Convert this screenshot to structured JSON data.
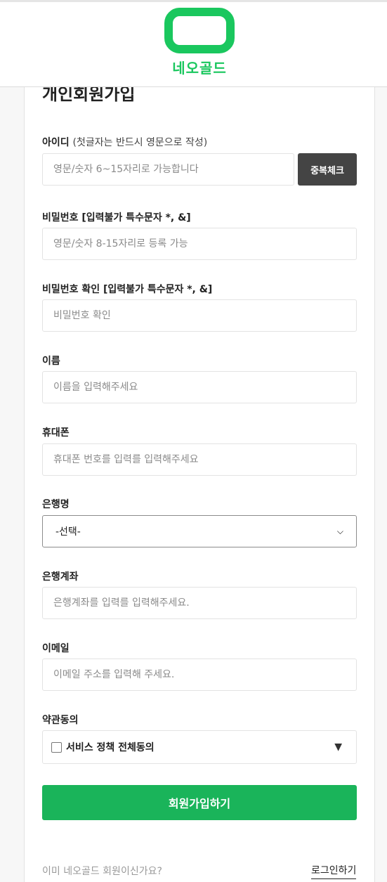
{
  "brand": {
    "name": "네오골드",
    "color": "#1ac75e"
  },
  "page_title": "개인회원가입",
  "fields": {
    "id": {
      "label": "아이디",
      "hint": "(첫글자는 반드시 영문으로 작성)",
      "placeholder": "영문/숫자 6~15자리로 가능합니다",
      "button": "중복체크"
    },
    "password": {
      "label": "비밀번호 [입력불가 특수문자 *, &]",
      "placeholder": "영문/숫자 8-15자리로 등록 가능"
    },
    "password_confirm": {
      "label": "비밀번호 확인 [입력불가 특수문자 *, &]",
      "placeholder": "비밀번호 확인"
    },
    "name": {
      "label": "이름",
      "placeholder": "이름을 입력해주세요"
    },
    "phone": {
      "label": "휴대폰",
      "placeholder": "휴대폰 번호를 입력를 입력해주세요"
    },
    "bank": {
      "label": "은행명",
      "selected": "-선택-"
    },
    "account": {
      "label": "은행계좌",
      "placeholder": "은행계좌를 입력를 입력해주세요."
    },
    "email": {
      "label": "이메일",
      "placeholder": "이메일 주소를 입력해 주세요."
    },
    "terms": {
      "label": "약관동의",
      "checkbox_label": "서비스 정책 전체동의"
    }
  },
  "submit_label": "회원가입하기",
  "footer": {
    "question": "이미 네오골드 회원이신가요?",
    "login_link": "로그인하기"
  },
  "icons": {
    "select_chevron": "chevron-down-icon",
    "terms_toggle": "triangle-down-icon"
  }
}
